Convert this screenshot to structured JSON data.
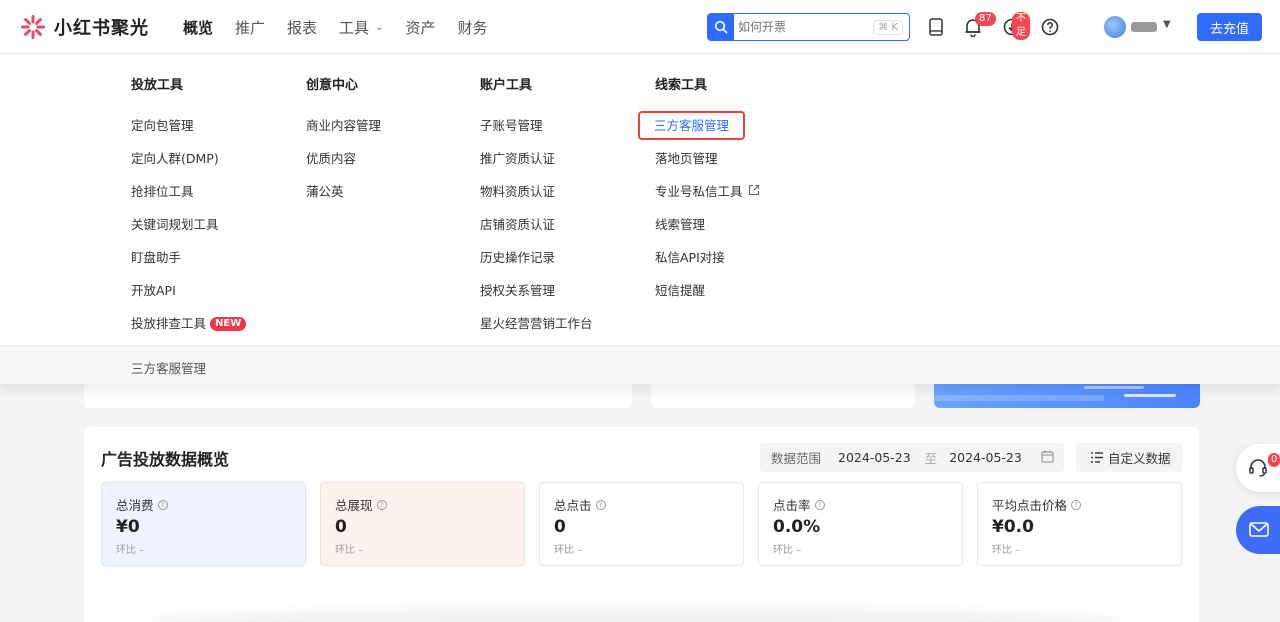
{
  "brand": {
    "name": "小红书聚光"
  },
  "nav": {
    "items": [
      {
        "label": "概览"
      },
      {
        "label": "推广"
      },
      {
        "label": "报表"
      },
      {
        "label": "工具"
      },
      {
        "label": "资产"
      },
      {
        "label": "财务"
      }
    ]
  },
  "search": {
    "placeholder": "如何开票",
    "shortcut": "⌘ K"
  },
  "header": {
    "notification_count": "87",
    "download_badge": "不足",
    "recharge_label": "去充值"
  },
  "menu": {
    "columns": [
      {
        "title": "投放工具",
        "items": [
          "定向包管理",
          "定向人群(DMP)",
          "抢排位工具",
          "关键词规划工具",
          "盯盘助手",
          "开放API",
          "投放排查工具"
        ]
      },
      {
        "title": "创意中心",
        "items": [
          "商业内容管理",
          "优质内容",
          "蒲公英"
        ]
      },
      {
        "title": "账户工具",
        "items": [
          "子账号管理",
          "推广资质认证",
          "物料资质认证",
          "店铺资质认证",
          "历史操作记录",
          "授权关系管理",
          "星火经营营销工作台"
        ]
      },
      {
        "title": "线索工具",
        "items": [
          "三方客服管理",
          "落地页管理",
          "专业号私信工具",
          "线索管理",
          "私信API对接",
          "短信提醒"
        ]
      }
    ],
    "new_badge": "NEW",
    "footer": "三方客服管理"
  },
  "overview": {
    "title": "广告投放数据概览",
    "range_label": "数据范围",
    "date_start": "2024-05-23",
    "date_sep": "至",
    "date_end": "2024-05-23",
    "custom_label": "自定义数据",
    "metrics": [
      {
        "label": "总消费",
        "value": "¥0",
        "compare": "环比 –"
      },
      {
        "label": "总展现",
        "value": "0",
        "compare": "环比 –"
      },
      {
        "label": "总点击",
        "value": "0",
        "compare": "环比 –"
      },
      {
        "label": "点击率",
        "value": "0.0%",
        "compare": "环比 –"
      },
      {
        "label": "平均点击价格",
        "value": "¥0.0",
        "compare": "环比 –"
      }
    ]
  },
  "float": {
    "support_badge": "0"
  },
  "colors": {
    "accent": "#2f6bff",
    "highlight_border": "#e8463a",
    "badge": "#f5474f"
  }
}
